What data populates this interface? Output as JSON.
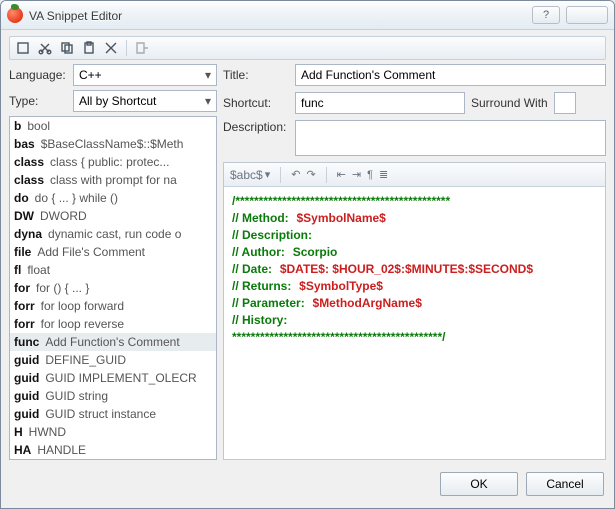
{
  "titlebar": {
    "icon": "tomato",
    "text": "VA Snippet Editor"
  },
  "toolbar": {
    "new": "new",
    "cut": "cut",
    "copy": "copy",
    "paste": "paste",
    "delete": "delete",
    "preview": "preview"
  },
  "left": {
    "language_label": "Language:",
    "language_value": "C++",
    "type_label": "Type:",
    "type_value": "All by Shortcut",
    "items": [
      {
        "k": "b",
        "v": "bool"
      },
      {
        "k": "bas",
        "v": "$BaseClassName$::$Meth"
      },
      {
        "k": "class",
        "v": "class   { public: protec..."
      },
      {
        "k": "class",
        "v": "class with prompt for na"
      },
      {
        "k": "do",
        "v": "do { ... } while ()"
      },
      {
        "k": "DW",
        "v": "DWORD"
      },
      {
        "k": "dyna",
        "v": "dynamic cast, run code o"
      },
      {
        "k": "file",
        "v": "Add File's Comment"
      },
      {
        "k": "fl",
        "v": "float"
      },
      {
        "k": "for",
        "v": "for () { ... }"
      },
      {
        "k": "forr",
        "v": "for loop forward"
      },
      {
        "k": "forr",
        "v": "for loop reverse"
      },
      {
        "k": "func",
        "v": "Add Function's Comment",
        "selected": true
      },
      {
        "k": "guid",
        "v": "DEFINE_GUID"
      },
      {
        "k": "guid",
        "v": "GUID IMPLEMENT_OLECR"
      },
      {
        "k": "guid",
        "v": "GUID string"
      },
      {
        "k": "guid",
        "v": "GUID struct instance"
      },
      {
        "k": "H",
        "v": "HWND"
      },
      {
        "k": "HA",
        "v": "HANDLE"
      }
    ]
  },
  "right": {
    "title_label": "Title:",
    "title_value": "Add Function's Comment",
    "shortcut_label": "Shortcut:",
    "shortcut_value": "func",
    "surround_label": "Surround With",
    "description_label": "Description:",
    "editor_tb": {
      "var": "$abc$",
      "indent_left": "←",
      "indent_right": "→",
      "align_left": "left",
      "align_center": "center",
      "para": "¶",
      "justify": "≡"
    },
    "code": {
      "stars_open": "**********************************************",
      "stars_close": "*********************************************/",
      "lines": [
        {
          "k": "Method:",
          "v": "$SymbolName$"
        },
        {
          "k": "Description:",
          "v": ""
        },
        {
          "k": "Author:",
          "v2": "Scorpio"
        },
        {
          "k": "Date:",
          "v": "$DATE$: $HOUR_02$:$MINUTE$:$SECOND$"
        },
        {
          "k": "Returns:",
          "v": "$SymbolType$"
        },
        {
          "k": "Parameter:",
          "v": "$MethodArgName$"
        },
        {
          "k": "History:",
          "v": ""
        }
      ]
    }
  },
  "bottom": {
    "ok": "OK",
    "cancel": "Cancel"
  }
}
